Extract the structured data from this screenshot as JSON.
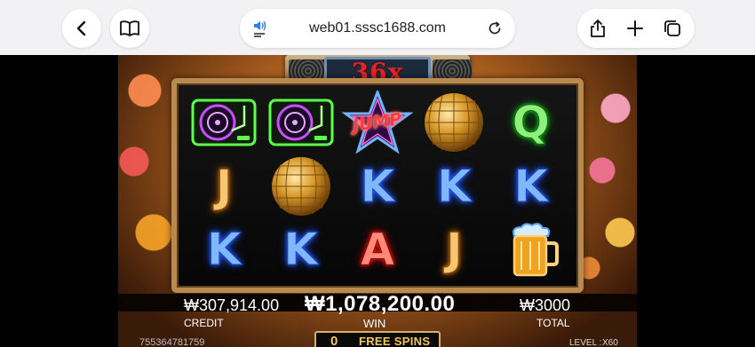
{
  "browser": {
    "url": "web01.sssc1688.com",
    "icons": {
      "back": "chevron-left-icon",
      "bookmarks": "book-icon",
      "reader": "speaker-icon",
      "reload": "reload-icon",
      "share": "share-icon",
      "new_tab": "plus-icon",
      "tabs": "tabs-icon"
    }
  },
  "game": {
    "multiplier": "36x",
    "reels": [
      [
        "turntable",
        "turntable",
        "jump-star",
        "disco-ball",
        "Q"
      ],
      [
        "J",
        "disco-ball",
        "K",
        "K",
        "K"
      ],
      [
        "K",
        "K",
        "A",
        "J",
        "beer-mug"
      ]
    ],
    "jump_text": "JUMP",
    "credit": {
      "value": "₩307,914.00",
      "label": "CREDIT"
    },
    "win": {
      "value": "₩1,078,200.00",
      "label": "WIN"
    },
    "total": {
      "value": "₩3000",
      "label": "TOTAL"
    },
    "free_spins": {
      "count": "0",
      "label": "FREE SPINS"
    },
    "player_id": "755364781759",
    "level": {
      "label": "LEVEL :",
      "value": "X60"
    },
    "colors": {
      "multiplier": "#e6232a",
      "free_spins": "#f3c760",
      "frame": "#b98a4d"
    }
  }
}
